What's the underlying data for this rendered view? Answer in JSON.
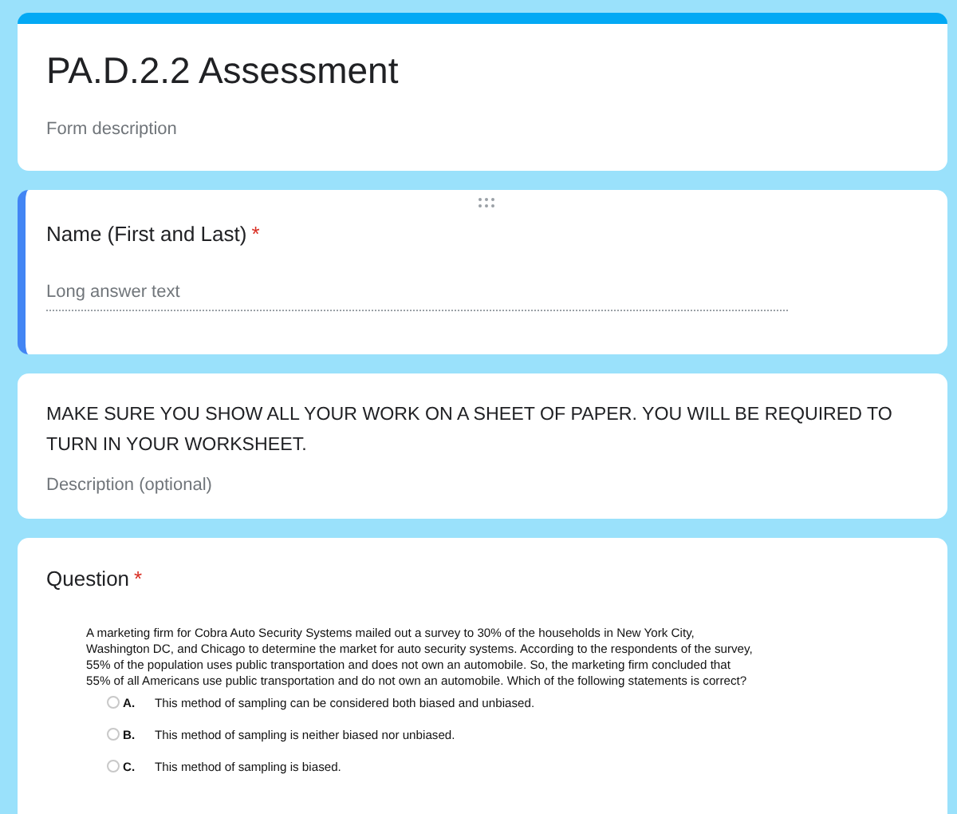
{
  "header": {
    "title": "PA.D.2.2 Assessment",
    "description": "Form description"
  },
  "name_question": {
    "label": "Name (First and Last)",
    "required_mark": "*",
    "placeholder": "Long answer text"
  },
  "section_text": {
    "title": "MAKE SURE YOU SHOW ALL YOUR WORK ON A SHEET OF PAPER. YOU WILL BE REQUIRED TO TURN IN YOUR WORKSHEET.",
    "description": "Description (optional)"
  },
  "question": {
    "label": "Question",
    "required_mark": "*",
    "prompt": "A marketing firm for Cobra Auto Security Systems mailed out a survey to 30% of the households in New York City, Washington DC, and Chicago to determine the market for auto security systems. According to the respondents of the survey, 55% of the population uses public transportation and does not own an automobile. So, the marketing firm concluded that 55% of all Americans use public transportation and do not own an automobile. Which of the following statements is correct?",
    "options": [
      {
        "letter": "A.",
        "text": "This method of sampling can be considered both biased and unbiased.",
        "selected": false
      },
      {
        "letter": "B.",
        "text": "This method of sampling is neither biased nor unbiased.",
        "selected": false
      },
      {
        "letter": "C.",
        "text": "This method of sampling is biased.",
        "selected": false
      }
    ]
  }
}
